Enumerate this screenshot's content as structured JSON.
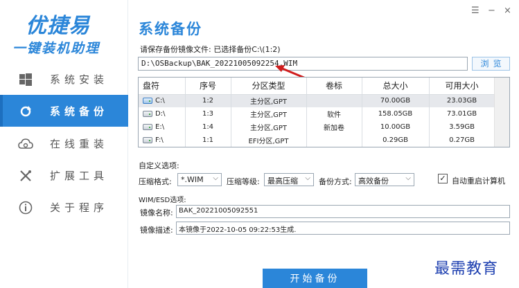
{
  "app": {
    "logo_title": "优捷易",
    "logo_subtitle": "一键装机助理"
  },
  "sidebar": {
    "items": [
      {
        "label": "系统安装",
        "icon": "windows-icon",
        "active": false
      },
      {
        "label": "系统备份",
        "icon": "refresh-icon",
        "active": true
      },
      {
        "label": "在线重装",
        "icon": "cloud-icon",
        "active": false
      },
      {
        "label": "扩展工具",
        "icon": "tools-icon",
        "active": false
      },
      {
        "label": "关于程序",
        "icon": "info-icon",
        "active": false
      }
    ]
  },
  "window_controls": {
    "menu": "☰",
    "minimize": "−",
    "close": "×"
  },
  "page": {
    "title": "系统备份",
    "prompt": "请保存备份镜像文件: 已选择备份C:\\(1:2)",
    "path_value": "D:\\OSBackup\\BAK_20221005092254.WIM",
    "browse_label": "浏览"
  },
  "table": {
    "columns": [
      "盘符",
      "序号",
      "分区类型",
      "卷标",
      "总大小",
      "可用大小"
    ],
    "rows": [
      {
        "drive": "C:\\",
        "index": "1:2",
        "type": "主分区,GPT",
        "label": "",
        "total": "70.00GB",
        "free": "23.03GB",
        "selected": true,
        "system": true
      },
      {
        "drive": "D:\\",
        "index": "1:3",
        "type": "主分区,GPT",
        "label": "软件",
        "total": "158.05GB",
        "free": "73.01GB",
        "selected": false,
        "system": false
      },
      {
        "drive": "E:\\",
        "index": "1:4",
        "type": "主分区,GPT",
        "label": "新加卷",
        "total": "10.00GB",
        "free": "3.59GB",
        "selected": false,
        "system": false
      },
      {
        "drive": "F:\\",
        "index": "1:1",
        "type": "EFI分区,GPT",
        "label": "",
        "total": "0.29GB",
        "free": "0.27GB",
        "selected": false,
        "system": false
      }
    ]
  },
  "options": {
    "title": "自定义选项:",
    "compress_format_label": "压缩格式:",
    "compress_format_value": "*.WIM",
    "compress_level_label": "压缩等级:",
    "compress_level_value": "最高压缩",
    "backup_mode_label": "备份方式:",
    "backup_mode_value": "高效备份",
    "auto_restart_label": "自动重启计算机",
    "auto_restart_checked": true
  },
  "wim": {
    "title": "WIM/ESD选项:",
    "name_label": "镜像名称:",
    "name_value": "BAK_20221005092551",
    "desc_label": "镜像描述:",
    "desc_value": "本镜像于2022-10-05 09:22:53生成."
  },
  "start_button": "开始备份",
  "watermark": "最需教育",
  "colors": {
    "accent": "#2b86d9",
    "annotation_arrow": "#d01c1c",
    "watermark": "#1d3fb0"
  }
}
